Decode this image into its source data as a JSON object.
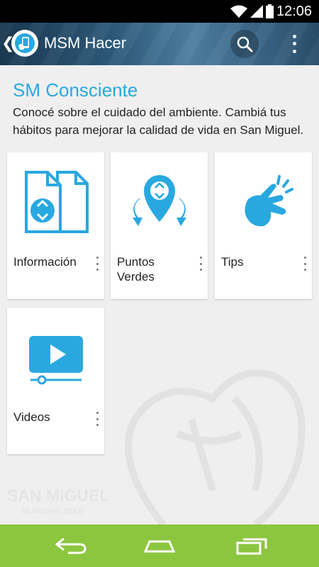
{
  "status_bar": {
    "time": "12:06"
  },
  "app_bar": {
    "back_glyph": "❮",
    "title": "MSM Hacer"
  },
  "page": {
    "heading": "SM Consciente",
    "description": "Conocé sobre el cuidado del ambiente. Cambiá tus hábitos para mejorar la calidad de vida en San Miguel."
  },
  "cards": [
    {
      "label": "Información",
      "icon": "documents-recycle-icon"
    },
    {
      "label": "Puntos Verdes",
      "icon": "recycle-points-icon"
    },
    {
      "label": "Tips",
      "icon": "snap-fingers-icon"
    },
    {
      "label": "Videos",
      "icon": "video-play-icon"
    }
  ],
  "watermark": {
    "line1": "SAN MIGUEL",
    "line2": "MUNICIPALIDAD"
  },
  "colors": {
    "accent": "#29a8e0",
    "nav_bar": "#8cc63f",
    "status_bar": "#000000",
    "background": "#efefef"
  }
}
